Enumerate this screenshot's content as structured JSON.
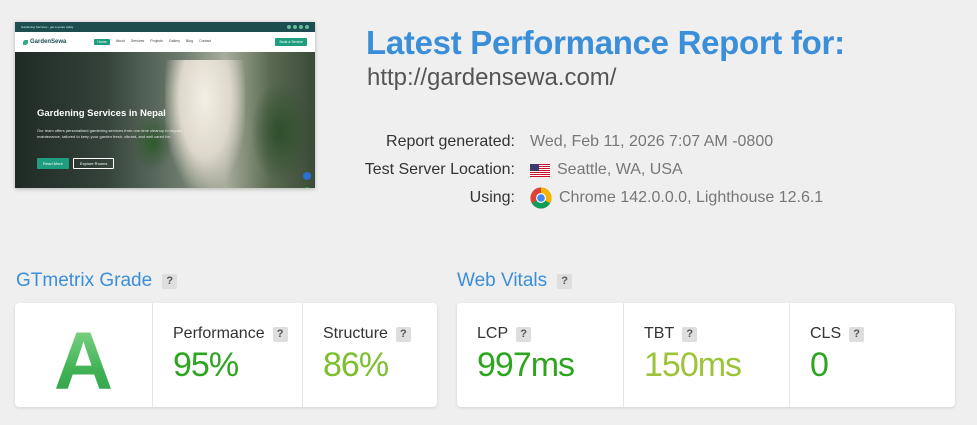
{
  "thumbnail": {
    "topbar_text": "Gardening Services - get a quote today",
    "logo": "GardenSewa",
    "menu": [
      "Home",
      "About",
      "Services",
      "Projects",
      "Gallery",
      "Blog",
      "Contact"
    ],
    "cta": "Book a Service",
    "hero_title": "Gardening Services in Nepal",
    "hero_text": "Our team offers personalised gardening services from one-time cleanup to regular maintenance, tailored to keep your garden fresh, vibrant, and well cared for.",
    "button_primary": "Read More",
    "button_secondary": "Explore Rooms"
  },
  "header": {
    "title": "Latest Performance Report for:",
    "url": "http://gardensewa.com/"
  },
  "info": {
    "report_generated_label": "Report generated:",
    "report_generated_value": "Wed, Feb 11, 2026 7:07 AM -0800",
    "location_label": "Test Server Location:",
    "location_value": "Seattle, WA, USA",
    "using_label": "Using:",
    "using_value": "Chrome 142.0.0.0, Lighthouse 12.6.1"
  },
  "grade_section": {
    "title": "GTmetrix Grade",
    "help": "?",
    "grade": "A",
    "performance_label": "Performance",
    "performance_value": "95%",
    "structure_label": "Structure",
    "structure_value": "86%"
  },
  "vitals_section": {
    "title": "Web Vitals",
    "help": "?",
    "lcp_label": "LCP",
    "lcp_value": "997ms",
    "tbt_label": "TBT",
    "tbt_value": "150ms",
    "cls_label": "CLS",
    "cls_value": "0"
  },
  "colors": {
    "accent_blue": "#3b8fd8",
    "good_green": "#2ea520",
    "ok_green": "#7cbf2f",
    "light_green": "#9cc43b",
    "grade_green": "#4dbb5f"
  },
  "icons": [
    "us-flag-icon",
    "chrome-icon",
    "help-icon"
  ]
}
